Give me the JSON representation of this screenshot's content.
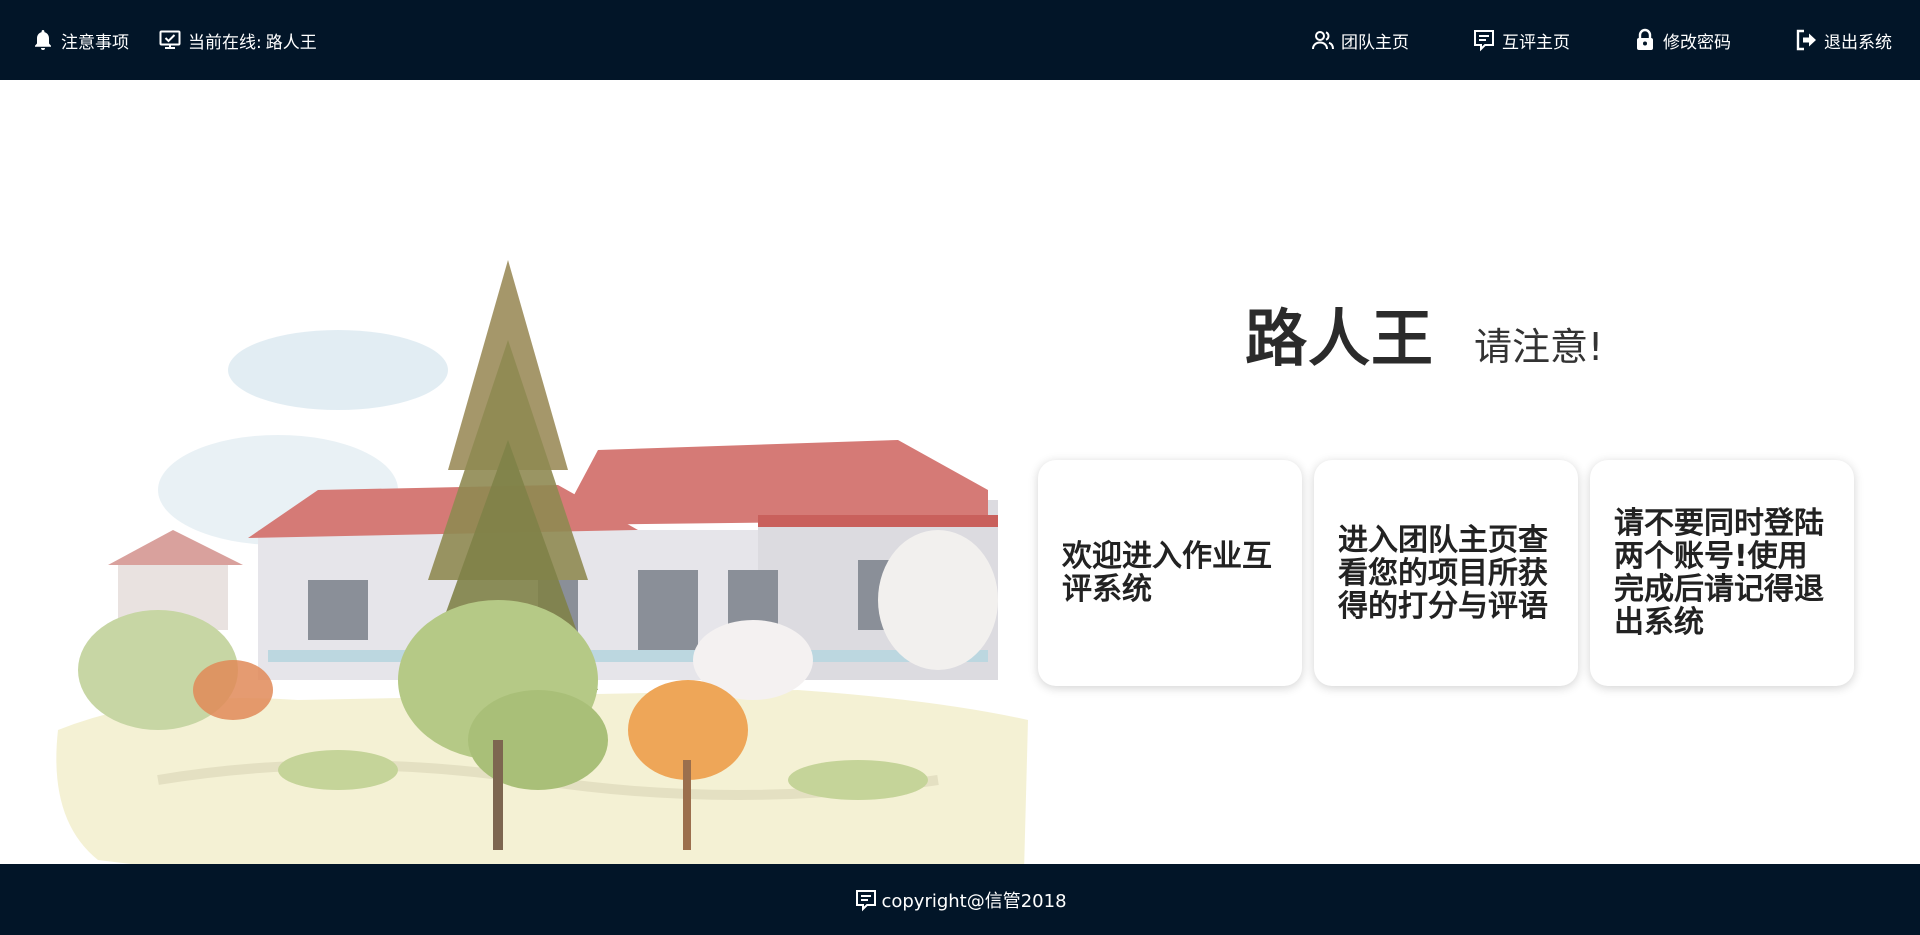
{
  "header": {
    "left": [
      {
        "label": "注意事项",
        "icon": "bell-icon"
      },
      {
        "label": "当前在线:",
        "icon": "monitor-check-icon",
        "user": "路人王"
      }
    ],
    "right": [
      {
        "label": "团队主页",
        "icon": "users-icon"
      },
      {
        "label": "互评主页",
        "icon": "comment-icon"
      },
      {
        "label": "修改密码",
        "icon": "lock-icon"
      },
      {
        "label": "退出系统",
        "icon": "sign-out-icon"
      }
    ]
  },
  "main": {
    "username": "路人王",
    "notice": "请注意!",
    "cards": [
      {
        "text": "欢迎进入作业互评系统"
      },
      {
        "text": "进入团队主页查看您的项目所获得的打分与评语"
      },
      {
        "text": "请不要同时登陆两个账号!使用完成后请记得退出系统"
      }
    ]
  },
  "footer": {
    "text": "copyright@信管2018",
    "icon": "comment-icon"
  },
  "colors": {
    "bar": "#021528",
    "text": "#222222"
  }
}
